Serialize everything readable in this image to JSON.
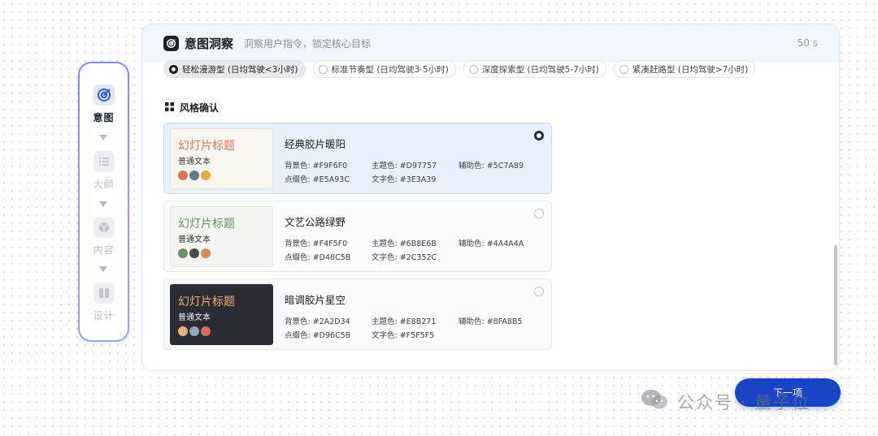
{
  "rail": {
    "steps": [
      {
        "label": "意图",
        "icon": "target-icon",
        "active": true
      },
      {
        "label": "大纲",
        "icon": "outline-list-icon",
        "active": false
      },
      {
        "label": "内容",
        "icon": "cube-icon",
        "active": false
      },
      {
        "label": "设计",
        "icon": "design-book-icon",
        "active": false
      }
    ]
  },
  "header": {
    "icon": "target-icon",
    "title": "意图洞察",
    "subtitle": "洞察用户指令，锁定核心目标",
    "timer": "50 s"
  },
  "pace_options": [
    {
      "label": "轻松漫游型 (日均驾驶<3小时)",
      "selected": true
    },
    {
      "label": "标准节奏型 (日均驾驶3-5小时)",
      "selected": false
    },
    {
      "label": "深度探索型 (日均驾驶5-7小时)",
      "selected": false
    },
    {
      "label": "紧凑赶路型 (日均驾驶>7小时)",
      "selected": false
    }
  ],
  "style_section": {
    "title": "风格确认",
    "icon": "grid-squares-icon"
  },
  "styles": [
    {
      "name": "经典胶片暖阳",
      "selected": true,
      "preview_title": "幻灯片标题",
      "preview_body": "普通文本",
      "bg": "背景色: #F9F6F0",
      "main": "主题色: #D97757",
      "aux": "辅助色: #5C7A89",
      "accent": "点缀色: #E5A93C",
      "text": "文字色: #3E3A39",
      "colors": {
        "bg": "#F9F6F0",
        "main": "#D97757",
        "aux": "#5C7A89",
        "accent": "#E5A93C",
        "text": "#3E3A39"
      }
    },
    {
      "name": "文艺公路绿野",
      "selected": false,
      "preview_title": "幻灯片标题",
      "preview_body": "普通文本",
      "bg": "背景色: #F4F5F0",
      "main": "主题色: #6B8E6B",
      "aux": "辅助色: #4A4A4A",
      "accent": "点缀色: #D48C5B",
      "text": "文字色: #2C352C",
      "colors": {
        "bg": "#F4F5F0",
        "main": "#6B8E6B",
        "aux": "#4A4A4A",
        "accent": "#D48C5B",
        "text": "#2C352C"
      }
    },
    {
      "name": "暗调胶片星空",
      "selected": false,
      "preview_title": "幻灯片标题",
      "preview_body": "普通文本",
      "bg": "背景色: #2A2D34",
      "main": "主题色: #E8B271",
      "aux": "辅助色: #8FA8B5",
      "accent": "点缀色: #D96C5B",
      "text": "文字色: #F5F5F5",
      "colors": {
        "bg": "#2A2D34",
        "main": "#E8B271",
        "aux": "#8FA8B5",
        "accent": "#D96C5B",
        "text": "#F5F5F5"
      }
    }
  ],
  "next_button": {
    "label": "下一项"
  },
  "watermark": {
    "text": "公众号 · 量子位",
    "icon": "wechat-icon"
  }
}
